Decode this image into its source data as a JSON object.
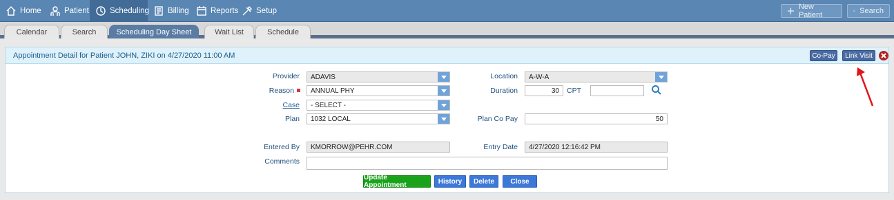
{
  "nav": {
    "items": [
      {
        "label": "Home",
        "icon": "home-icon"
      },
      {
        "label": "Patient",
        "icon": "patient-icon"
      },
      {
        "label": "Scheduling",
        "icon": "clock-icon"
      },
      {
        "label": "Billing",
        "icon": "billing-icon"
      },
      {
        "label": "Reports",
        "icon": "calendar-icon"
      },
      {
        "label": "Setup",
        "icon": "tools-icon"
      }
    ],
    "new_patient": "New Patient",
    "search": "Search"
  },
  "tabs": [
    "Calendar",
    "Search",
    "Scheduling Day Sheet",
    "Wait List",
    "Schedule"
  ],
  "panel": {
    "title": "Appointment Detail for Patient JOHN, ZIKI on 4/27/2020 11:00 AM",
    "copay_button": "Co-Pay",
    "link_visit_button": "Link Visit"
  },
  "form": {
    "provider_label": "Provider",
    "provider_value": "ADAVIS",
    "reason_label": "Reason",
    "reason_value": "ANNUAL PHY",
    "case_label": "Case",
    "case_value": "- SELECT -",
    "plan_label": "Plan",
    "plan_value": "1032 LOCAL",
    "location_label": "Location",
    "location_value": "A-W-A",
    "duration_label": "Duration",
    "duration_value": "30",
    "cpt_label": "CPT",
    "cpt_value": "",
    "plan_copay_label": "Plan Co Pay",
    "plan_copay_value": "50",
    "entered_by_label": "Entered By",
    "entered_by_value": "KMORROW@PEHR.COM",
    "entry_date_label": "Entry Date",
    "entry_date_value": "4/27/2020 12:16:42 PM",
    "comments_label": "Comments",
    "comments_value": ""
  },
  "actions": {
    "update": "Update Appointment",
    "history": "History",
    "delete": "Delete",
    "close": "Close"
  },
  "colors": {
    "nav_bg": "#5a86b3",
    "tab_active": "#5a7ca3",
    "header_bg": "#dff2fb",
    "update_green": "#1aa31a",
    "action_blue": "#3c78d8",
    "annotation_red": "#e3151a"
  }
}
